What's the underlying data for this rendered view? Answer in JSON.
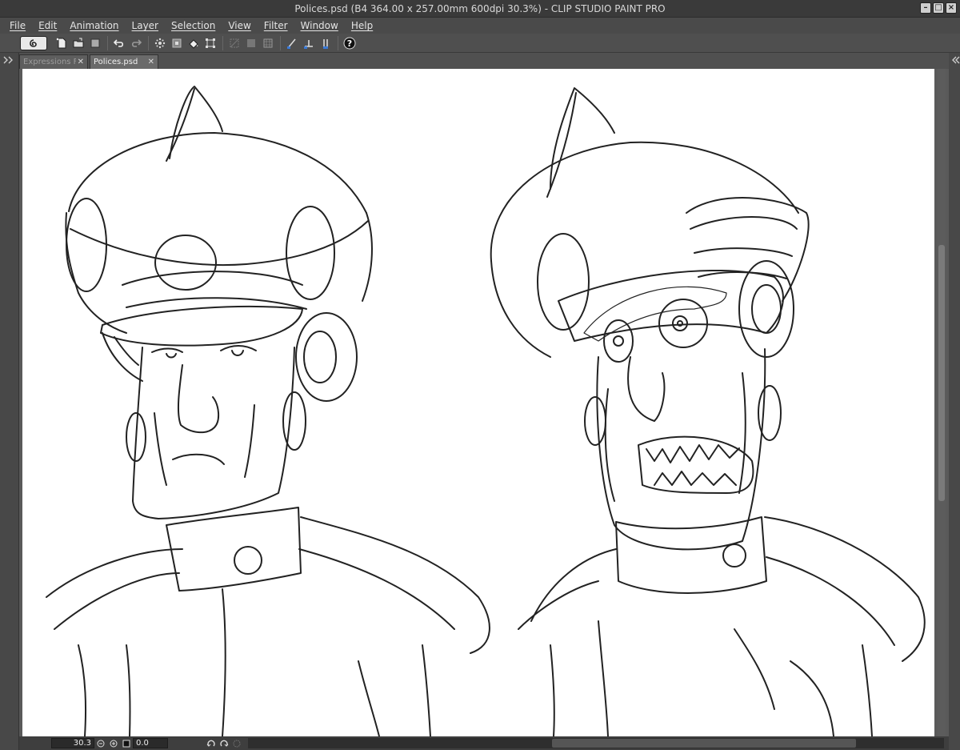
{
  "window": {
    "title": "Polices.psd (B4 364.00 x 257.00mm 600dpi 30.3%)  - CLIP STUDIO PAINT PRO",
    "controls": [
      "minimize",
      "maximize",
      "close"
    ]
  },
  "menu": {
    "items": [
      "File",
      "Edit",
      "Animation",
      "Layer",
      "Selection",
      "View",
      "Filter",
      "Window",
      "Help"
    ]
  },
  "toolbar": {
    "icons": [
      "clip-studio-logo-icon",
      "new-file-icon",
      "open-file-icon",
      "save-icon",
      "undo-icon",
      "redo-icon",
      "clear-icon",
      "fill-icon",
      "transform-icon",
      "grid-icon",
      "snap-ruler-icon",
      "snap-special-ruler-icon",
      "snap-grid-icon",
      "help-icon"
    ]
  },
  "tabs": [
    {
      "label": "Expressions Flint",
      "active": false
    },
    {
      "label": "Polices.psd",
      "active": true
    }
  ],
  "status": {
    "zoom": "30.3",
    "rotation": "0.0"
  },
  "colors": {
    "background": "#555555",
    "canvas": "#ffffff",
    "ink": "#222222"
  }
}
